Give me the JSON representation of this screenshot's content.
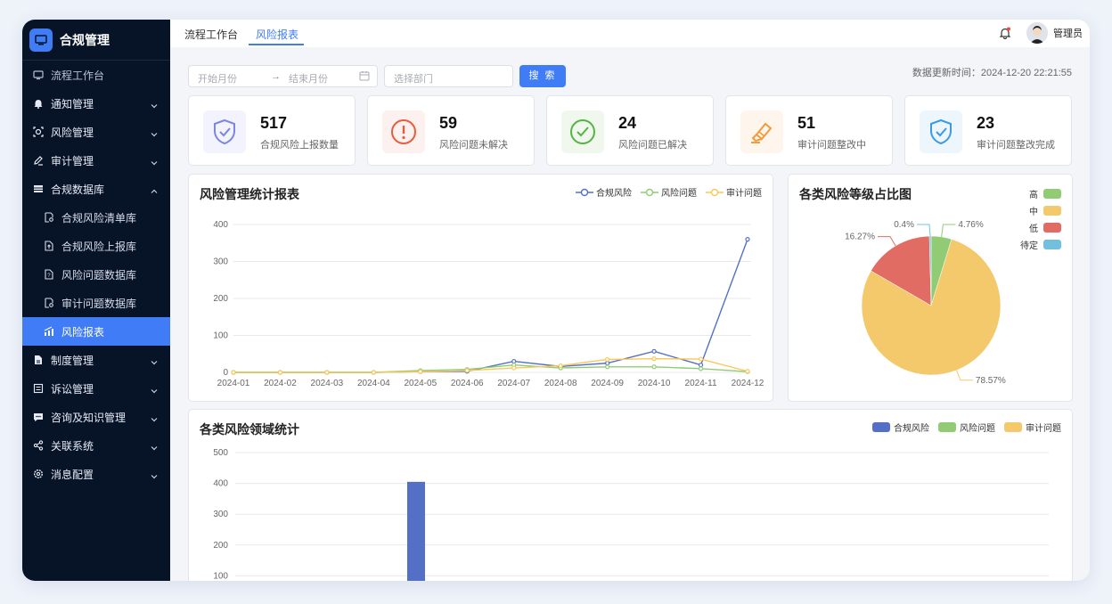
{
  "sidebar": {
    "brand": "合规管理",
    "items": [
      {
        "label": "流程工作台",
        "icon": "monitor-icon",
        "type": "top"
      },
      {
        "label": "通知管理",
        "icon": "bell-icon",
        "type": "group",
        "chevron": "down"
      },
      {
        "label": "风险管理",
        "icon": "radar-icon",
        "type": "group",
        "chevron": "down"
      },
      {
        "label": "审计管理",
        "icon": "pen-icon",
        "type": "group",
        "chevron": "down"
      },
      {
        "label": "合规数据库",
        "icon": "database-icon",
        "type": "group",
        "chevron": "up"
      },
      {
        "label": "合规风险清单库",
        "icon": "doc-search-icon",
        "type": "sub"
      },
      {
        "label": "合规风险上报库",
        "icon": "doc-upload-icon",
        "type": "sub"
      },
      {
        "label": "风险问题数据库",
        "icon": "doc-question-icon",
        "type": "sub"
      },
      {
        "label": "审计问题数据库",
        "icon": "doc-search-icon",
        "type": "sub"
      },
      {
        "label": "风险报表",
        "icon": "chart-icon",
        "type": "sub",
        "active": true
      },
      {
        "label": "制度管理",
        "icon": "file-icon",
        "type": "group",
        "chevron": "down"
      },
      {
        "label": "诉讼管理",
        "icon": "list-icon",
        "type": "group",
        "chevron": "down"
      },
      {
        "label": "咨询及知识管理",
        "icon": "message-icon",
        "type": "group",
        "chevron": "down"
      },
      {
        "label": "关联系统",
        "icon": "share-icon",
        "type": "group",
        "chevron": "down"
      },
      {
        "label": "消息配置",
        "icon": "gear-icon",
        "type": "group",
        "chevron": "down"
      }
    ]
  },
  "topbar": {
    "tabs": [
      "流程工作台",
      "风险报表"
    ],
    "user": "管理员"
  },
  "filter": {
    "start_placeholder": "开始月份",
    "end_placeholder": "结束月份",
    "separator": "→",
    "dept_placeholder": "选择部门",
    "search_label": "搜 索",
    "update_time": "数据更新时间：2024-12-20 22:21:55"
  },
  "cards": [
    {
      "value": "517",
      "label": "合规风险上报数量",
      "icon": "shield-check-icon",
      "color": "#7b86e3",
      "bg": "#f2f3fd"
    },
    {
      "value": "59",
      "label": "风险问题未解决",
      "icon": "alert-circle-icon",
      "color": "#e85b3c",
      "bg": "#fdf1ef"
    },
    {
      "value": "24",
      "label": "风险问题已解决",
      "icon": "check-circle-icon",
      "color": "#53b541",
      "bg": "#f0f8ee"
    },
    {
      "value": "51",
      "label": "审计问题整改中",
      "icon": "highlighter-icon",
      "color": "#f49a3a",
      "bg": "#fef5ec"
    },
    {
      "value": "23",
      "label": "审计问题整改完成",
      "icon": "shield-check-icon",
      "color": "#3a9ae8",
      "bg": "#edf5fd"
    }
  ],
  "line_panel": {
    "title": "风险管理统计报表"
  },
  "pie_panel": {
    "title": "各类风险等级占比图"
  },
  "bar_panel": {
    "title": "各类风险领域统计"
  },
  "chart_data": [
    {
      "type": "line",
      "title": "风险管理统计报表",
      "x": [
        "2024-01",
        "2024-02",
        "2024-03",
        "2024-04",
        "2024-05",
        "2024-06",
        "2024-07",
        "2024-08",
        "2024-09",
        "2024-10",
        "2024-11",
        "2024-12"
      ],
      "ylim": [
        0,
        400
      ],
      "yticks": [
        0,
        100,
        200,
        300,
        400
      ],
      "legend_position": "top-right",
      "series": [
        {
          "name": "合规风险",
          "color": "#5470c6",
          "values": [
            0,
            0,
            0,
            0,
            2,
            3,
            30,
            16,
            25,
            57,
            20,
            360
          ]
        },
        {
          "name": "风险问题",
          "color": "#91cc75",
          "values": [
            0,
            0,
            0,
            0,
            5,
            8,
            20,
            12,
            15,
            15,
            10,
            2
          ]
        },
        {
          "name": "审计问题",
          "color": "#fac858",
          "values": [
            0,
            0,
            0,
            0,
            2,
            5,
            12,
            18,
            35,
            37,
            36,
            3
          ]
        }
      ]
    },
    {
      "type": "pie",
      "title": "各类风险等级占比图",
      "legend_position": "top-right",
      "slices": [
        {
          "name": "高",
          "value": 4.76,
          "label": "4.76%",
          "color": "#91cc75"
        },
        {
          "name": "中",
          "value": 78.57,
          "label": "78.57%",
          "color": "#f3c96b"
        },
        {
          "name": "低",
          "value": 16.27,
          "label": "16.27%",
          "color": "#e06c63"
        },
        {
          "name": "待定",
          "value": 0.4,
          "label": "0.4%",
          "color": "#73c0de"
        }
      ]
    },
    {
      "type": "bar",
      "title": "各类风险领域统计",
      "ylim": [
        0,
        500
      ],
      "yticks": [
        100,
        200,
        300,
        400,
        500
      ],
      "legend_position": "top-right",
      "series": [
        {
          "name": "合规风险",
          "color": "#5470c6",
          "values": [
            405
          ]
        },
        {
          "name": "风险问题",
          "color": "#91cc75",
          "values": []
        },
        {
          "name": "审计问题",
          "color": "#f3c96b",
          "values": []
        }
      ]
    }
  ]
}
